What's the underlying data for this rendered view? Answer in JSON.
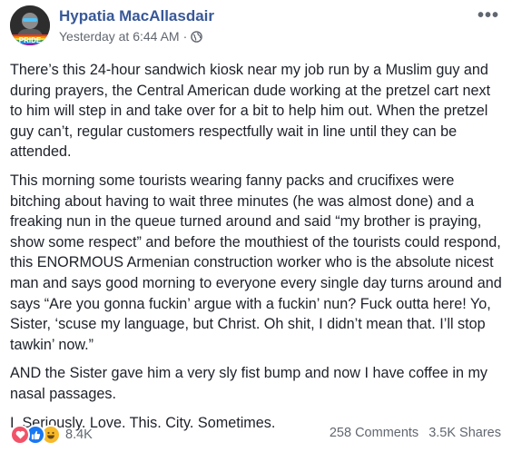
{
  "post": {
    "author": "Hypatia MacAllasdair",
    "timestamp": "Yesterday at 6:44 AM",
    "separator": "·",
    "privacy_icon": "globe-icon",
    "avatar_badge": "PRIDE",
    "more_label": "•••",
    "paragraphs": [
      "There’s this 24-hour sandwich kiosk near my job run by a Muslim guy and during prayers, the Central American dude working at the pretzel cart next to him will step in and take over for a bit to help him out. When the pretzel guy can’t, regular customers respectfully wait in line until they can be attended.",
      "This morning some tourists wearing fanny packs and crucifixes were bitching about having to wait three minutes (he was almost done) and a freaking nun in the queue turned around and said “my brother is praying, show some respect” and before the mouthiest of the tourists could respond, this ENORMOUS Armenian construction worker who is the absolute nicest man and says good morning to everyone every single day turns around and says “Are you gonna fuckin’ argue with a fuckin’ nun? Fuck outta here! Yo, Sister, ‘scuse my language, but Christ. Oh shit, I didn’t mean that. I’ll stop tawkin’ now.”",
      "AND the Sister gave him a very sly fist bump and now I have coffee in my nasal passages.",
      "I. Seriously. Love. This. City. Sometimes."
    ]
  },
  "footer": {
    "reactions": [
      "love",
      "like",
      "haha"
    ],
    "reaction_count": "8.4K",
    "comments": "258 Comments",
    "shares": "3.5K Shares"
  },
  "colors": {
    "author_link": "#385898",
    "meta_text": "#616770",
    "body_text": "#1d2129",
    "love": "#f25268",
    "like": "#1877f2",
    "haha": "#f7b928"
  }
}
